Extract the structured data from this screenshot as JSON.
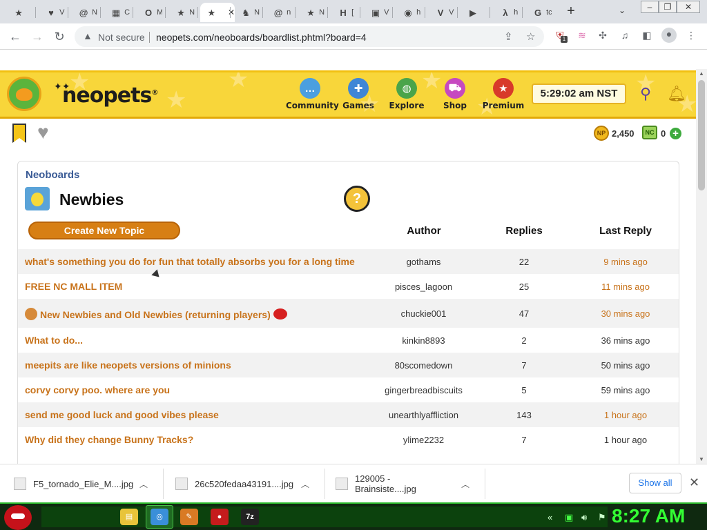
{
  "browser": {
    "tabs": [
      {
        "icon_name": "star-icon",
        "glyph": "★",
        "label": "",
        "active": false
      },
      {
        "icon_name": "heart-icon",
        "glyph": "♥",
        "label": "V",
        "active": false
      },
      {
        "icon_name": "at-icon",
        "glyph": "@",
        "label": "N",
        "active": false
      },
      {
        "icon_name": "windows-icon",
        "glyph": "▦",
        "label": "C",
        "active": false
      },
      {
        "icon_name": "outlook-icon",
        "glyph": "O",
        "label": "M",
        "active": false
      },
      {
        "icon_name": "star-icon",
        "glyph": "★",
        "label": "N",
        "active": false
      },
      {
        "icon_name": "star-icon",
        "glyph": "★",
        "label": "",
        "active": true
      },
      {
        "icon_name": "pet-icon",
        "glyph": "♞",
        "label": "N",
        "active": false
      },
      {
        "icon_name": "at-icon",
        "glyph": "@",
        "label": "n",
        "active": false
      },
      {
        "icon_name": "star-icon",
        "glyph": "★",
        "label": "N",
        "active": false
      },
      {
        "icon_name": "h-icon",
        "glyph": "H",
        "label": "[",
        "active": false
      },
      {
        "icon_name": "clapper-icon",
        "glyph": "▣",
        "label": "V",
        "active": false
      },
      {
        "icon_name": "globe-icon",
        "glyph": "◉",
        "label": "h",
        "active": false
      },
      {
        "icon_name": "v-icon",
        "glyph": "V",
        "label": "V",
        "active": false
      },
      {
        "icon_name": "youtube-icon",
        "glyph": "▶",
        "label": "",
        "active": false
      },
      {
        "icon_name": "lambda-icon",
        "glyph": "λ",
        "label": "h",
        "active": false
      },
      {
        "icon_name": "google-icon",
        "glyph": "G",
        "label": "tc",
        "active": false
      }
    ],
    "close_glyph": "✕",
    "new_tab_glyph": "+",
    "security_label": "Not secure",
    "url": "neopets.com/neoboards/boardlist.phtml?board=4",
    "extension_badge": "1"
  },
  "header": {
    "logo": "neopets",
    "logo_mark": "®",
    "nav": [
      {
        "label": "Community",
        "icon_name": "speech-bubble-icon",
        "color": "#4b9fe0"
      },
      {
        "label": "Games",
        "icon_name": "gamepad-icon",
        "color": "#3f86d6"
      },
      {
        "label": "Explore",
        "icon_name": "globe-icon",
        "color": "#4aa44a"
      },
      {
        "label": "Shop",
        "icon_name": "cart-icon",
        "color": "#c649c0"
      },
      {
        "label": "Premium",
        "icon_name": "premium-star-icon",
        "color": "#d83a2a"
      }
    ],
    "clock": "5:29:02 am NST"
  },
  "wallet": {
    "np_icon_label": "NP",
    "np": "2,450",
    "nc_icon_label": "NC",
    "nc": "0"
  },
  "board": {
    "breadcrumb": "Neoboards",
    "title": "Newbies",
    "help_glyph": "?",
    "create_button": "Create New Topic",
    "columns": {
      "author": "Author",
      "replies": "Replies",
      "last": "Last Reply"
    },
    "topics": [
      {
        "title": "what's something you do for fun that totally absorbs you for a long time",
        "author": "gothams",
        "replies": "22",
        "last": "9 mins ago",
        "recent": true
      },
      {
        "title": "FREE NC MALL ITEM",
        "author": "pisces_lagoon",
        "replies": "25",
        "last": "11 mins ago",
        "recent": true
      },
      {
        "title": "New Newbies and Old Newbies (returning players)",
        "author": "chuckie001",
        "replies": "47",
        "last": "30 mins ago",
        "recent": true,
        "pre_icon": "pet-face-icon",
        "post_icon": "red-pet-icon"
      },
      {
        "title": "What to do...",
        "author": "kinkin8893",
        "replies": "2",
        "last": "36 mins ago",
        "recent": false
      },
      {
        "title": "meepits are like neopets versions of minions",
        "author": "80scomedown",
        "replies": "7",
        "last": "50 mins ago",
        "recent": false
      },
      {
        "title": "corvy corvy poo. where are you",
        "author": "gingerbreadbiscuits",
        "replies": "5",
        "last": "59 mins ago",
        "recent": false
      },
      {
        "title": "send me good luck and good vibes please",
        "author": "unearthlyaffliction",
        "replies": "143",
        "last": "1 hour ago",
        "recent": true
      },
      {
        "title": "Why did they change Bunny Tracks?",
        "author": "ylime2232",
        "replies": "7",
        "last": "1 hour ago",
        "recent": false
      }
    ]
  },
  "downloads": {
    "items": [
      {
        "name": "F5_tornado_Elie_M....jpg"
      },
      {
        "name": "26c520fedaa43191....jpg"
      },
      {
        "name": "129005 - Brainsiste....jpg"
      }
    ],
    "show_all": "Show all"
  },
  "taskbar": {
    "apps": [
      {
        "icon_name": "folder-icon",
        "color": "#e8c43a",
        "glyph": "▤"
      },
      {
        "icon_name": "chrome-icon",
        "color": "#3a8fd9",
        "glyph": "◎"
      },
      {
        "icon_name": "paint-icon",
        "color": "#d97a24",
        "glyph": "✎"
      },
      {
        "icon_name": "angry-bird-icon",
        "color": "#c51c1c",
        "glyph": "●"
      },
      {
        "icon_name": "7zip-icon",
        "color": "#222222",
        "glyph": "7z"
      }
    ],
    "clock": "8:27 AM"
  }
}
